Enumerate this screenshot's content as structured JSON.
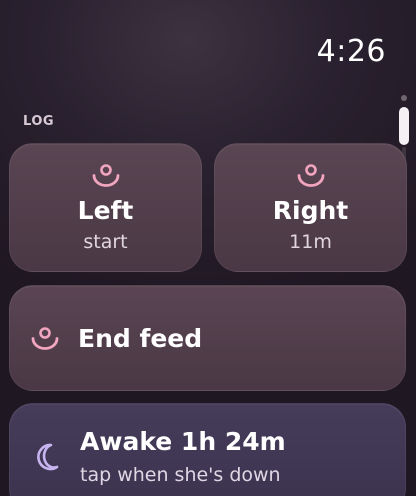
{
  "status": {
    "time": "4:26"
  },
  "log": {
    "section_label": "LOG",
    "left": {
      "title": "Left",
      "subtitle": "start",
      "icon": "breast-icon"
    },
    "right": {
      "title": "Right",
      "subtitle": "11m",
      "icon": "breast-icon"
    },
    "end_feed": {
      "title": "End feed",
      "icon": "breast-icon"
    },
    "awake": {
      "title": "Awake 1h 24m",
      "subtitle": "tap when she's down",
      "icon": "moon-icon"
    }
  },
  "colors": {
    "feed_accent": "#f2a5be",
    "sleep_accent": "#c7b5f2",
    "feed_card": "#543f4e",
    "sleep_card": "#423954"
  }
}
